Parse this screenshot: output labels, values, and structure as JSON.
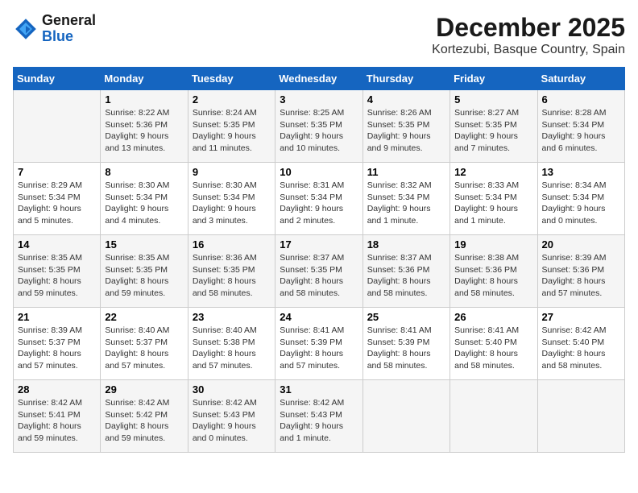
{
  "logo": {
    "line1": "General",
    "line2": "Blue"
  },
  "title": "December 2025",
  "subtitle": "Kortezubi, Basque Country, Spain",
  "days_of_week": [
    "Sunday",
    "Monday",
    "Tuesday",
    "Wednesday",
    "Thursday",
    "Friday",
    "Saturday"
  ],
  "weeks": [
    [
      {
        "day": "",
        "sunrise": "",
        "sunset": "",
        "daylight": ""
      },
      {
        "day": "1",
        "sunrise": "Sunrise: 8:22 AM",
        "sunset": "Sunset: 5:36 PM",
        "daylight": "Daylight: 9 hours and 13 minutes."
      },
      {
        "day": "2",
        "sunrise": "Sunrise: 8:24 AM",
        "sunset": "Sunset: 5:35 PM",
        "daylight": "Daylight: 9 hours and 11 minutes."
      },
      {
        "day": "3",
        "sunrise": "Sunrise: 8:25 AM",
        "sunset": "Sunset: 5:35 PM",
        "daylight": "Daylight: 9 hours and 10 minutes."
      },
      {
        "day": "4",
        "sunrise": "Sunrise: 8:26 AM",
        "sunset": "Sunset: 5:35 PM",
        "daylight": "Daylight: 9 hours and 9 minutes."
      },
      {
        "day": "5",
        "sunrise": "Sunrise: 8:27 AM",
        "sunset": "Sunset: 5:35 PM",
        "daylight": "Daylight: 9 hours and 7 minutes."
      },
      {
        "day": "6",
        "sunrise": "Sunrise: 8:28 AM",
        "sunset": "Sunset: 5:34 PM",
        "daylight": "Daylight: 9 hours and 6 minutes."
      }
    ],
    [
      {
        "day": "7",
        "sunrise": "Sunrise: 8:29 AM",
        "sunset": "Sunset: 5:34 PM",
        "daylight": "Daylight: 9 hours and 5 minutes."
      },
      {
        "day": "8",
        "sunrise": "Sunrise: 8:30 AM",
        "sunset": "Sunset: 5:34 PM",
        "daylight": "Daylight: 9 hours and 4 minutes."
      },
      {
        "day": "9",
        "sunrise": "Sunrise: 8:30 AM",
        "sunset": "Sunset: 5:34 PM",
        "daylight": "Daylight: 9 hours and 3 minutes."
      },
      {
        "day": "10",
        "sunrise": "Sunrise: 8:31 AM",
        "sunset": "Sunset: 5:34 PM",
        "daylight": "Daylight: 9 hours and 2 minutes."
      },
      {
        "day": "11",
        "sunrise": "Sunrise: 8:32 AM",
        "sunset": "Sunset: 5:34 PM",
        "daylight": "Daylight: 9 hours and 1 minute."
      },
      {
        "day": "12",
        "sunrise": "Sunrise: 8:33 AM",
        "sunset": "Sunset: 5:34 PM",
        "daylight": "Daylight: 9 hours and 1 minute."
      },
      {
        "day": "13",
        "sunrise": "Sunrise: 8:34 AM",
        "sunset": "Sunset: 5:34 PM",
        "daylight": "Daylight: 9 hours and 0 minutes."
      }
    ],
    [
      {
        "day": "14",
        "sunrise": "Sunrise: 8:35 AM",
        "sunset": "Sunset: 5:35 PM",
        "daylight": "Daylight: 8 hours and 59 minutes."
      },
      {
        "day": "15",
        "sunrise": "Sunrise: 8:35 AM",
        "sunset": "Sunset: 5:35 PM",
        "daylight": "Daylight: 8 hours and 59 minutes."
      },
      {
        "day": "16",
        "sunrise": "Sunrise: 8:36 AM",
        "sunset": "Sunset: 5:35 PM",
        "daylight": "Daylight: 8 hours and 58 minutes."
      },
      {
        "day": "17",
        "sunrise": "Sunrise: 8:37 AM",
        "sunset": "Sunset: 5:35 PM",
        "daylight": "Daylight: 8 hours and 58 minutes."
      },
      {
        "day": "18",
        "sunrise": "Sunrise: 8:37 AM",
        "sunset": "Sunset: 5:36 PM",
        "daylight": "Daylight: 8 hours and 58 minutes."
      },
      {
        "day": "19",
        "sunrise": "Sunrise: 8:38 AM",
        "sunset": "Sunset: 5:36 PM",
        "daylight": "Daylight: 8 hours and 58 minutes."
      },
      {
        "day": "20",
        "sunrise": "Sunrise: 8:39 AM",
        "sunset": "Sunset: 5:36 PM",
        "daylight": "Daylight: 8 hours and 57 minutes."
      }
    ],
    [
      {
        "day": "21",
        "sunrise": "Sunrise: 8:39 AM",
        "sunset": "Sunset: 5:37 PM",
        "daylight": "Daylight: 8 hours and 57 minutes."
      },
      {
        "day": "22",
        "sunrise": "Sunrise: 8:40 AM",
        "sunset": "Sunset: 5:37 PM",
        "daylight": "Daylight: 8 hours and 57 minutes."
      },
      {
        "day": "23",
        "sunrise": "Sunrise: 8:40 AM",
        "sunset": "Sunset: 5:38 PM",
        "daylight": "Daylight: 8 hours and 57 minutes."
      },
      {
        "day": "24",
        "sunrise": "Sunrise: 8:41 AM",
        "sunset": "Sunset: 5:39 PM",
        "daylight": "Daylight: 8 hours and 57 minutes."
      },
      {
        "day": "25",
        "sunrise": "Sunrise: 8:41 AM",
        "sunset": "Sunset: 5:39 PM",
        "daylight": "Daylight: 8 hours and 58 minutes."
      },
      {
        "day": "26",
        "sunrise": "Sunrise: 8:41 AM",
        "sunset": "Sunset: 5:40 PM",
        "daylight": "Daylight: 8 hours and 58 minutes."
      },
      {
        "day": "27",
        "sunrise": "Sunrise: 8:42 AM",
        "sunset": "Sunset: 5:40 PM",
        "daylight": "Daylight: 8 hours and 58 minutes."
      }
    ],
    [
      {
        "day": "28",
        "sunrise": "Sunrise: 8:42 AM",
        "sunset": "Sunset: 5:41 PM",
        "daylight": "Daylight: 8 hours and 59 minutes."
      },
      {
        "day": "29",
        "sunrise": "Sunrise: 8:42 AM",
        "sunset": "Sunset: 5:42 PM",
        "daylight": "Daylight: 8 hours and 59 minutes."
      },
      {
        "day": "30",
        "sunrise": "Sunrise: 8:42 AM",
        "sunset": "Sunset: 5:43 PM",
        "daylight": "Daylight: 9 hours and 0 minutes."
      },
      {
        "day": "31",
        "sunrise": "Sunrise: 8:42 AM",
        "sunset": "Sunset: 5:43 PM",
        "daylight": "Daylight: 9 hours and 1 minute."
      },
      {
        "day": "",
        "sunrise": "",
        "sunset": "",
        "daylight": ""
      },
      {
        "day": "",
        "sunrise": "",
        "sunset": "",
        "daylight": ""
      },
      {
        "day": "",
        "sunrise": "",
        "sunset": "",
        "daylight": ""
      }
    ]
  ]
}
